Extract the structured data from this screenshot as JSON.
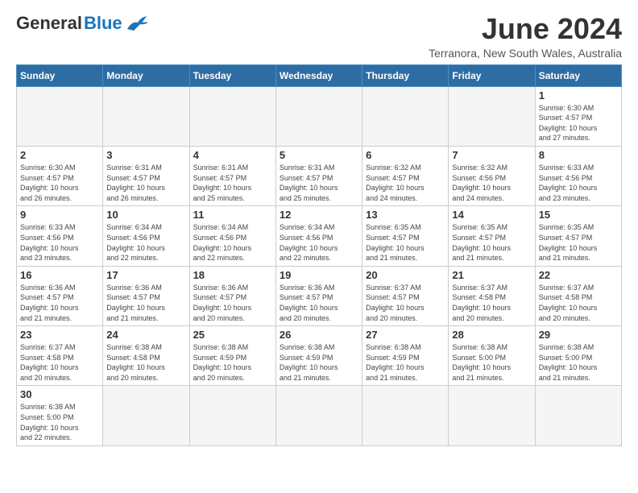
{
  "header": {
    "logo_general": "General",
    "logo_blue": "Blue",
    "month_title": "June 2024",
    "location": "Terranora, New South Wales, Australia"
  },
  "weekdays": [
    "Sunday",
    "Monday",
    "Tuesday",
    "Wednesday",
    "Thursday",
    "Friday",
    "Saturday"
  ],
  "weeks": [
    [
      {
        "day": "",
        "info": ""
      },
      {
        "day": "",
        "info": ""
      },
      {
        "day": "",
        "info": ""
      },
      {
        "day": "",
        "info": ""
      },
      {
        "day": "",
        "info": ""
      },
      {
        "day": "",
        "info": ""
      },
      {
        "day": "1",
        "info": "Sunrise: 6:30 AM\nSunset: 4:57 PM\nDaylight: 10 hours\nand 27 minutes."
      }
    ],
    [
      {
        "day": "2",
        "info": "Sunrise: 6:30 AM\nSunset: 4:57 PM\nDaylight: 10 hours\nand 26 minutes."
      },
      {
        "day": "3",
        "info": "Sunrise: 6:31 AM\nSunset: 4:57 PM\nDaylight: 10 hours\nand 26 minutes."
      },
      {
        "day": "4",
        "info": "Sunrise: 6:31 AM\nSunset: 4:57 PM\nDaylight: 10 hours\nand 25 minutes."
      },
      {
        "day": "5",
        "info": "Sunrise: 6:31 AM\nSunset: 4:57 PM\nDaylight: 10 hours\nand 25 minutes."
      },
      {
        "day": "6",
        "info": "Sunrise: 6:32 AM\nSunset: 4:57 PM\nDaylight: 10 hours\nand 24 minutes."
      },
      {
        "day": "7",
        "info": "Sunrise: 6:32 AM\nSunset: 4:56 PM\nDaylight: 10 hours\nand 24 minutes."
      },
      {
        "day": "8",
        "info": "Sunrise: 6:33 AM\nSunset: 4:56 PM\nDaylight: 10 hours\nand 23 minutes."
      }
    ],
    [
      {
        "day": "9",
        "info": "Sunrise: 6:33 AM\nSunset: 4:56 PM\nDaylight: 10 hours\nand 23 minutes."
      },
      {
        "day": "10",
        "info": "Sunrise: 6:34 AM\nSunset: 4:56 PM\nDaylight: 10 hours\nand 22 minutes."
      },
      {
        "day": "11",
        "info": "Sunrise: 6:34 AM\nSunset: 4:56 PM\nDaylight: 10 hours\nand 22 minutes."
      },
      {
        "day": "12",
        "info": "Sunrise: 6:34 AM\nSunset: 4:56 PM\nDaylight: 10 hours\nand 22 minutes."
      },
      {
        "day": "13",
        "info": "Sunrise: 6:35 AM\nSunset: 4:57 PM\nDaylight: 10 hours\nand 21 minutes."
      },
      {
        "day": "14",
        "info": "Sunrise: 6:35 AM\nSunset: 4:57 PM\nDaylight: 10 hours\nand 21 minutes."
      },
      {
        "day": "15",
        "info": "Sunrise: 6:35 AM\nSunset: 4:57 PM\nDaylight: 10 hours\nand 21 minutes."
      }
    ],
    [
      {
        "day": "16",
        "info": "Sunrise: 6:36 AM\nSunset: 4:57 PM\nDaylight: 10 hours\nand 21 minutes."
      },
      {
        "day": "17",
        "info": "Sunrise: 6:36 AM\nSunset: 4:57 PM\nDaylight: 10 hours\nand 21 minutes."
      },
      {
        "day": "18",
        "info": "Sunrise: 6:36 AM\nSunset: 4:57 PM\nDaylight: 10 hours\nand 20 minutes."
      },
      {
        "day": "19",
        "info": "Sunrise: 6:36 AM\nSunset: 4:57 PM\nDaylight: 10 hours\nand 20 minutes."
      },
      {
        "day": "20",
        "info": "Sunrise: 6:37 AM\nSunset: 4:57 PM\nDaylight: 10 hours\nand 20 minutes."
      },
      {
        "day": "21",
        "info": "Sunrise: 6:37 AM\nSunset: 4:58 PM\nDaylight: 10 hours\nand 20 minutes."
      },
      {
        "day": "22",
        "info": "Sunrise: 6:37 AM\nSunset: 4:58 PM\nDaylight: 10 hours\nand 20 minutes."
      }
    ],
    [
      {
        "day": "23",
        "info": "Sunrise: 6:37 AM\nSunset: 4:58 PM\nDaylight: 10 hours\nand 20 minutes."
      },
      {
        "day": "24",
        "info": "Sunrise: 6:38 AM\nSunset: 4:58 PM\nDaylight: 10 hours\nand 20 minutes."
      },
      {
        "day": "25",
        "info": "Sunrise: 6:38 AM\nSunset: 4:59 PM\nDaylight: 10 hours\nand 20 minutes."
      },
      {
        "day": "26",
        "info": "Sunrise: 6:38 AM\nSunset: 4:59 PM\nDaylight: 10 hours\nand 21 minutes."
      },
      {
        "day": "27",
        "info": "Sunrise: 6:38 AM\nSunset: 4:59 PM\nDaylight: 10 hours\nand 21 minutes."
      },
      {
        "day": "28",
        "info": "Sunrise: 6:38 AM\nSunset: 5:00 PM\nDaylight: 10 hours\nand 21 minutes."
      },
      {
        "day": "29",
        "info": "Sunrise: 6:38 AM\nSunset: 5:00 PM\nDaylight: 10 hours\nand 21 minutes."
      }
    ],
    [
      {
        "day": "30",
        "info": "Sunrise: 6:38 AM\nSunset: 5:00 PM\nDaylight: 10 hours\nand 22 minutes."
      },
      {
        "day": "",
        "info": ""
      },
      {
        "day": "",
        "info": ""
      },
      {
        "day": "",
        "info": ""
      },
      {
        "day": "",
        "info": ""
      },
      {
        "day": "",
        "info": ""
      },
      {
        "day": "",
        "info": ""
      }
    ]
  ]
}
